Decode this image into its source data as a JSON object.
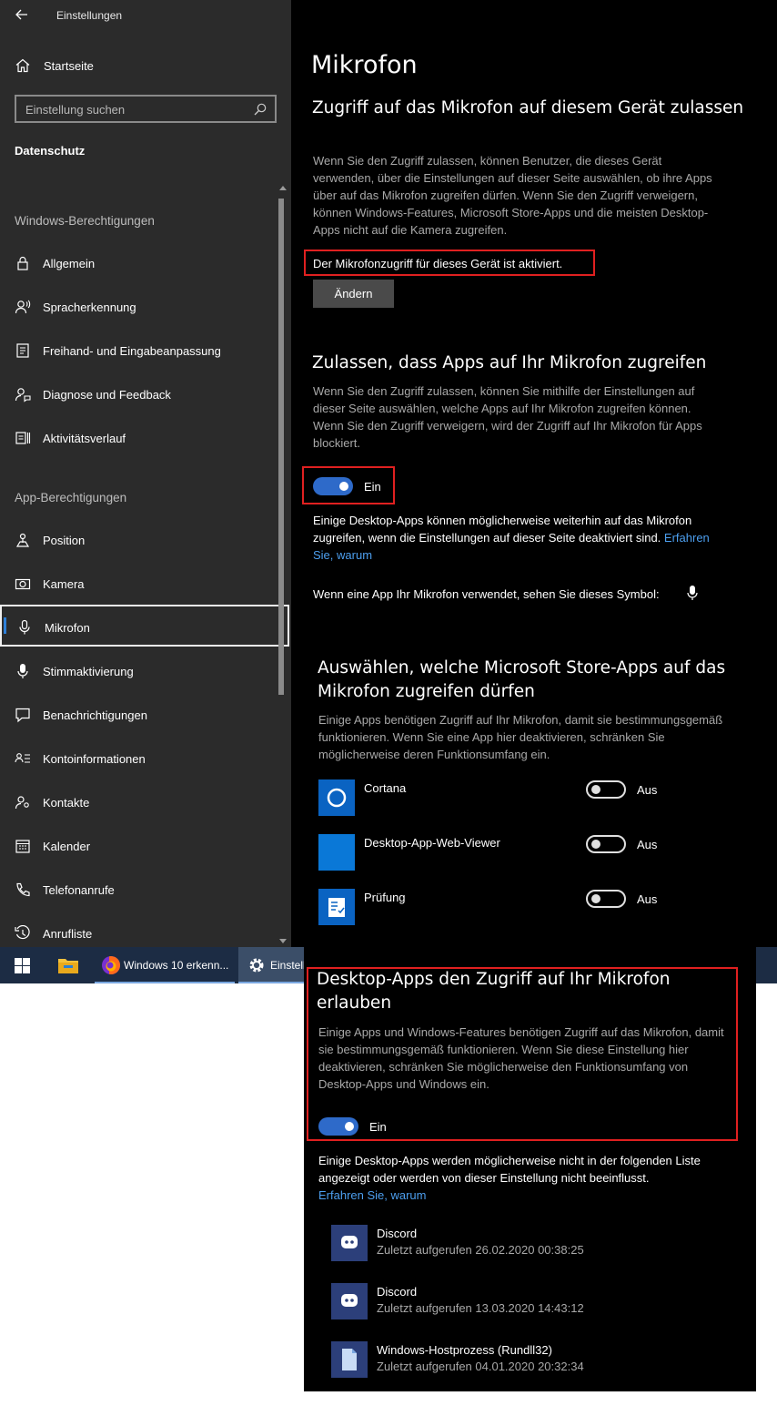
{
  "window": {
    "title": "Einstellungen"
  },
  "sidebar": {
    "home_label": "Startseite",
    "search_placeholder": "Einstellung suchen",
    "section_title": "Datenschutz",
    "group_windows": "Windows-Berechtigungen",
    "windows_items": [
      {
        "label": "Allgemein",
        "icon": "lock-icon"
      },
      {
        "label": "Spracherkennung",
        "icon": "speech-icon"
      },
      {
        "label": "Freihand- und Eingabeanpassung",
        "icon": "pen-input-icon"
      },
      {
        "label": "Diagnose und Feedback",
        "icon": "feedback-icon"
      },
      {
        "label": "Aktivitätsverlauf",
        "icon": "history-icon"
      }
    ],
    "group_apps": "App-Berechtigungen",
    "app_items": [
      {
        "label": "Position",
        "icon": "location-icon"
      },
      {
        "label": "Kamera",
        "icon": "camera-icon"
      },
      {
        "label": "Mikrofon",
        "icon": "microphone-icon",
        "selected": true
      },
      {
        "label": "Stimmaktivierung",
        "icon": "voice-activation-icon"
      },
      {
        "label": "Benachrichtigungen",
        "icon": "notification-icon"
      },
      {
        "label": "Kontoinformationen",
        "icon": "account-info-icon"
      },
      {
        "label": "Kontakte",
        "icon": "contacts-icon"
      },
      {
        "label": "Kalender",
        "icon": "calendar-icon"
      },
      {
        "label": "Telefonanrufe",
        "icon": "phone-icon"
      },
      {
        "label": "Anrufliste",
        "icon": "call-history-icon"
      }
    ]
  },
  "main": {
    "page_title": "Mikrofon",
    "device_access": {
      "heading": "Zugriff auf das Mikrofon auf diesem Gerät zulassen",
      "description": "Wenn Sie den Zugriff zulassen, können Benutzer, die dieses Gerät verwenden, über die Einstellungen auf dieser Seite auswählen, ob ihre Apps über auf das Mikrofon zugreifen dürfen. Wenn Sie den Zugriff verweigern, können Windows-Features, Microsoft Store-Apps und die meisten Desktop-Apps nicht auf die Kamera zugreifen.",
      "status": "Der Mikrofonzugriff für dieses Gerät ist aktiviert.",
      "change_button": "Ändern"
    },
    "app_access": {
      "heading": "Zulassen, dass Apps auf Ihr Mikrofon zugreifen",
      "description": "Wenn Sie den Zugriff zulassen, können Sie mithilfe der Einstellungen auf dieser Seite auswählen, welche Apps auf Ihr Mikrofon zugreifen können. Wenn Sie den Zugriff verweigern, wird der Zugriff auf Ihr Mikrofon für Apps blockiert.",
      "toggle_label": "Ein",
      "note": "Einige Desktop-Apps können möglicherweise weiterhin auf das Mikrofon zugreifen, wenn die Einstellungen auf dieser Seite deaktiviert sind.",
      "note_link": "Erfahren Sie, warum",
      "symbol_text": "Wenn eine App Ihr Mikrofon verwendet, sehen Sie dieses Symbol:"
    },
    "store_apps": {
      "heading": "Auswählen, welche Microsoft Store-Apps auf das Mikrofon zugreifen dürfen",
      "description": "Einige Apps benötigen Zugriff auf Ihr Mikrofon, damit sie bestimmungsgemäß funktionieren. Wenn Sie eine App hier deaktivieren, schränken Sie möglicherweise deren Funktionsumfang ein.",
      "apps": [
        {
          "name": "Cortana",
          "state": "Aus",
          "icon": "cortana-icon"
        },
        {
          "name": "Desktop-App-Web-Viewer",
          "state": "Aus",
          "icon": "web-viewer-icon"
        },
        {
          "name": "Prüfung",
          "state": "Aus",
          "icon": "test-check-icon"
        }
      ]
    }
  },
  "taskbar": {
    "items": [
      {
        "icon": "windows-start-icon"
      },
      {
        "icon": "file-explorer-icon"
      },
      {
        "icon": "firefox-icon",
        "label": "Windows 10 erkenn..."
      },
      {
        "icon": "settings-gear-icon",
        "label": "Einstell"
      }
    ]
  },
  "desktop_apps": {
    "heading": "Desktop-Apps den Zugriff auf Ihr Mikrofon erlauben",
    "description": "Einige Apps und Windows-Features benötigen Zugriff auf das Mikrofon, damit sie bestimmungsgemäß funktionieren. Wenn Sie diese Einstellung hier deaktivieren, schränken Sie möglicherweise den Funktionsumfang von Desktop-Apps und Windows ein.",
    "toggle_label": "Ein",
    "note": "Einige Desktop-Apps werden möglicherweise nicht in der folgenden Liste angezeigt oder werden von dieser Einstellung nicht beeinflusst.",
    "note_link": "Erfahren Sie, warum",
    "apps": [
      {
        "name": "Discord",
        "last": "Zuletzt aufgerufen 26.02.2020 00:38:25",
        "icon": "discord-icon"
      },
      {
        "name": "Discord",
        "last": "Zuletzt aufgerufen 13.03.2020 14:43:12",
        "icon": "discord-icon"
      },
      {
        "name": "Windows-Hostprozess (Rundll32)",
        "last": "Zuletzt aufgerufen 04.01.2020 20:32:34",
        "icon": "document-icon"
      }
    ]
  }
}
